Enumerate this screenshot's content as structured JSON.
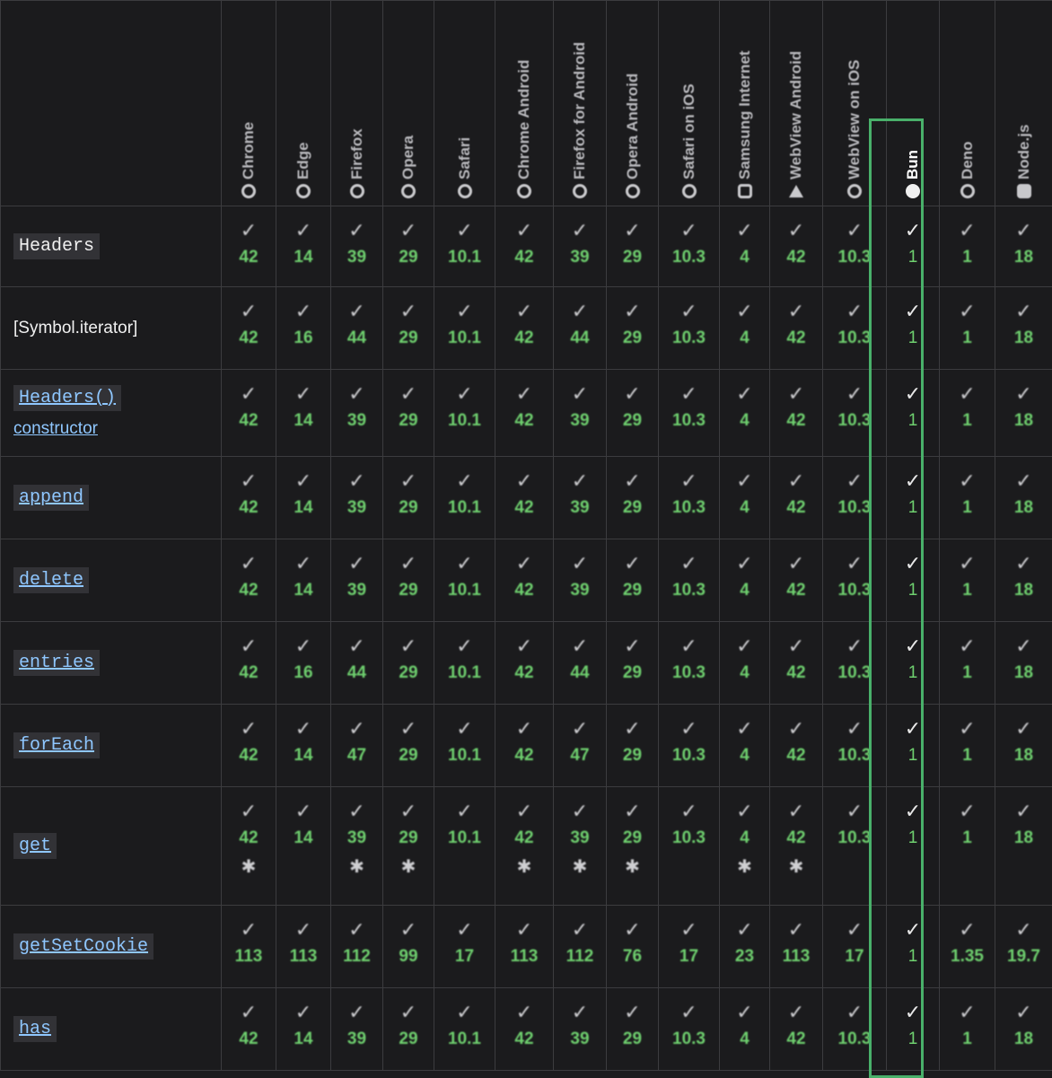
{
  "browsers": [
    {
      "name": "Chrome",
      "icon": "chrome-icon"
    },
    {
      "name": "Edge",
      "icon": "edge-icon"
    },
    {
      "name": "Firefox",
      "icon": "firefox-icon"
    },
    {
      "name": "Opera",
      "icon": "opera-icon"
    },
    {
      "name": "Safari",
      "icon": "safari-icon"
    },
    {
      "name": "Chrome Android",
      "icon": "chrome-icon"
    },
    {
      "name": "Firefox for Android",
      "icon": "firefox-icon"
    },
    {
      "name": "Opera Android",
      "icon": "opera-icon"
    },
    {
      "name": "Safari on iOS",
      "icon": "safari-icon"
    },
    {
      "name": "Samsung Internet",
      "icon": "samsung-internet-icon"
    },
    {
      "name": "WebView Android",
      "icon": "android-icon"
    },
    {
      "name": "WebView on iOS",
      "icon": "safari-icon"
    },
    {
      "name": "Bun",
      "icon": "bun-icon",
      "highlighted": true
    },
    {
      "name": "Deno",
      "icon": "deno-icon"
    },
    {
      "name": "Node.js",
      "icon": "nodejs-icon"
    }
  ],
  "check_glyph": "✓",
  "note_glyph": "✱",
  "highlight_color": "#49b06a",
  "version_color": "#6fd06f",
  "rows": [
    {
      "lines": [
        "Headers"
      ],
      "style": "code",
      "link": false,
      "versions": [
        "42",
        "14",
        "39",
        "29",
        "10.1",
        "42",
        "39",
        "29",
        "10.3",
        "4",
        "42",
        "10.3",
        "1",
        "1",
        "18"
      ],
      "notes": []
    },
    {
      "lines": [
        "[Symbol.iterator]"
      ],
      "style": "plain",
      "link": false,
      "versions": [
        "42",
        "16",
        "44",
        "29",
        "10.1",
        "42",
        "44",
        "29",
        "10.3",
        "4",
        "42",
        "10.3",
        "1",
        "1",
        "18"
      ],
      "notes": []
    },
    {
      "lines": [
        "Headers()",
        "constructor"
      ],
      "style": "mixed",
      "link": true,
      "versions": [
        "42",
        "14",
        "39",
        "29",
        "10.1",
        "42",
        "39",
        "29",
        "10.3",
        "4",
        "42",
        "10.3",
        "1",
        "1",
        "18"
      ],
      "notes": []
    },
    {
      "lines": [
        "append"
      ],
      "style": "code",
      "link": true,
      "versions": [
        "42",
        "14",
        "39",
        "29",
        "10.1",
        "42",
        "39",
        "29",
        "10.3",
        "4",
        "42",
        "10.3",
        "1",
        "1",
        "18"
      ],
      "notes": []
    },
    {
      "lines": [
        "delete"
      ],
      "style": "code",
      "link": true,
      "versions": [
        "42",
        "14",
        "39",
        "29",
        "10.1",
        "42",
        "39",
        "29",
        "10.3",
        "4",
        "42",
        "10.3",
        "1",
        "1",
        "18"
      ],
      "notes": []
    },
    {
      "lines": [
        "entries"
      ],
      "style": "code",
      "link": true,
      "versions": [
        "42",
        "16",
        "44",
        "29",
        "10.1",
        "42",
        "44",
        "29",
        "10.3",
        "4",
        "42",
        "10.3",
        "1",
        "1",
        "18"
      ],
      "notes": []
    },
    {
      "lines": [
        "forEach"
      ],
      "style": "code",
      "link": true,
      "versions": [
        "42",
        "14",
        "47",
        "29",
        "10.1",
        "42",
        "47",
        "29",
        "10.3",
        "4",
        "42",
        "10.3",
        "1",
        "1",
        "18"
      ],
      "notes": []
    },
    {
      "lines": [
        "get"
      ],
      "style": "code",
      "link": true,
      "versions": [
        "42",
        "14",
        "39",
        "29",
        "10.1",
        "42",
        "39",
        "29",
        "10.3",
        "4",
        "42",
        "10.3",
        "1",
        "1",
        "18"
      ],
      "notes": [
        0,
        2,
        3,
        5,
        6,
        7,
        9,
        10
      ]
    },
    {
      "lines": [
        "getSetCookie"
      ],
      "style": "code",
      "link": true,
      "versions": [
        "113",
        "113",
        "112",
        "99",
        "17",
        "113",
        "112",
        "76",
        "17",
        "23",
        "113",
        "17",
        "1",
        "1.35",
        "19.7"
      ],
      "notes": []
    },
    {
      "lines": [
        "has"
      ],
      "style": "code",
      "link": true,
      "versions": [
        "42",
        "14",
        "39",
        "29",
        "10.1",
        "42",
        "39",
        "29",
        "10.3",
        "4",
        "42",
        "10.3",
        "1",
        "1",
        "18"
      ],
      "notes": []
    }
  ]
}
